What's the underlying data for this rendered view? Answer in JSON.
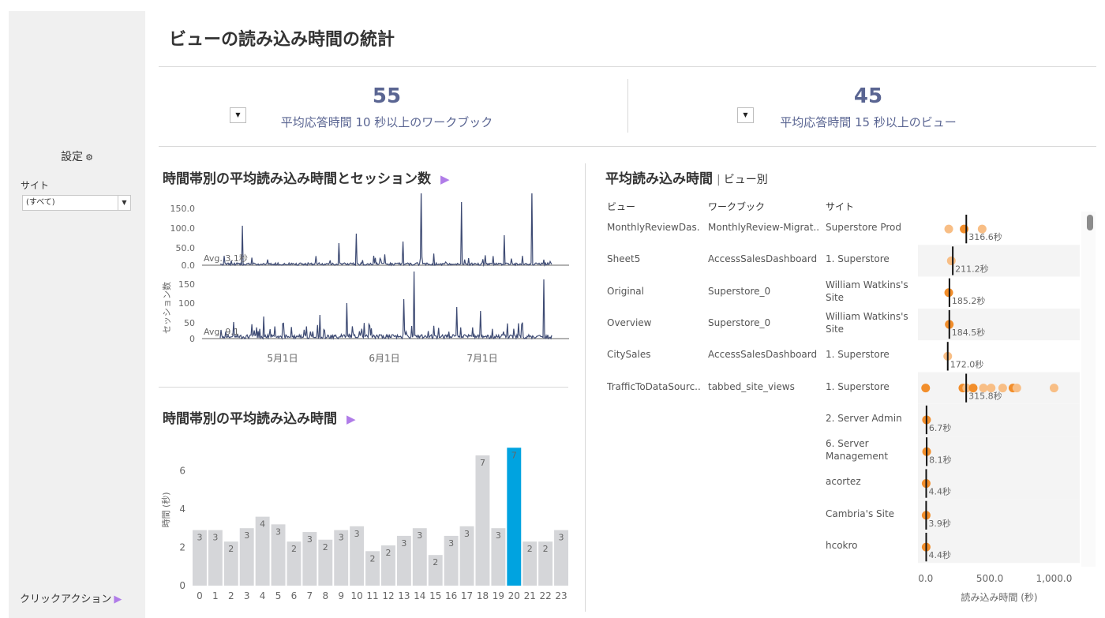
{
  "page": {
    "title": "ビューの読み込み時間の統計"
  },
  "sidebar": {
    "settings_label": "設定",
    "settings_icon": "gear-icon",
    "site_label": "サイト",
    "site_value": "(すべて)",
    "click_action_label": "クリックアクション"
  },
  "kpis": [
    {
      "value": "55",
      "label": "平均応答時間 10 秒以上のワークブック"
    },
    {
      "value": "45",
      "label": "平均応答時間 15 秒以上のビュー"
    }
  ],
  "colors": {
    "line": "#3d4a73",
    "bar": "#d5d6d9",
    "bar_highlight": "#00a3e0",
    "dot_dark": "#f28e2b",
    "dot_light": "#f8be85",
    "accent_tri": "#b07ce8",
    "kpi_text": "#5a6592"
  },
  "line_chart": {
    "title": "時間帯別の平均読み込み時間とセッション数",
    "top_yticks": [
      "150.0",
      "100.0",
      "50.0",
      "0.0"
    ],
    "top_avg_label": "Avg. 3.1秒",
    "bottom_ylabel": "セッション数",
    "bottom_yticks": [
      "150",
      "100",
      "50",
      "0"
    ],
    "bottom_avg_label": "Avg. 9.1",
    "xticks": [
      "5月1日",
      "6月1日",
      "7月1日"
    ]
  },
  "chart_data": [
    {
      "type": "bar",
      "title": "時間帯別の平均読み込み時間",
      "ylabel": "時間 (秒)",
      "categories": [
        "0",
        "1",
        "2",
        "3",
        "4",
        "5",
        "6",
        "7",
        "8",
        "9",
        "10",
        "11",
        "12",
        "13",
        "14",
        "15",
        "16",
        "17",
        "18",
        "19",
        "20",
        "21",
        "22",
        "23"
      ],
      "values": [
        3,
        3,
        2,
        3,
        4,
        3,
        2,
        3,
        2,
        3,
        3,
        2,
        2,
        3,
        3,
        2,
        3,
        3,
        7,
        3,
        7,
        2,
        2,
        3
      ],
      "heights": [
        2.9,
        2.9,
        2.3,
        3.0,
        3.6,
        3.2,
        2.3,
        2.8,
        2.4,
        2.9,
        3.1,
        1.8,
        2.1,
        2.6,
        3.0,
        1.6,
        2.6,
        3.1,
        6.8,
        3.0,
        7.2,
        2.3,
        2.3,
        2.9
      ],
      "highlight_index": 20,
      "yticks": [
        0,
        2,
        4,
        6
      ],
      "ylim": [
        0,
        7.5
      ],
      "grid": false
    },
    {
      "type": "scatter",
      "title": "平均読み込み時間",
      "subtitle": "ビュー別",
      "xlabel": "読み込み時間 (秒)",
      "xticks": [
        "0.0",
        "500.0",
        "1,000.0"
      ],
      "xlim": [
        -60,
        1200
      ],
      "columns": [
        "ビュー",
        "ワークブック",
        "サイト"
      ],
      "rows": [
        {
          "view": "MonthlyReviewDas..",
          "workbook": "MonthlyReview-Migrat..",
          "site": "Superstore Prod",
          "avg": 316.6,
          "avg_label": "316.6秒",
          "points": [
            180,
            300,
            440
          ],
          "dark": [
            300
          ]
        },
        {
          "view": "Sheet5",
          "workbook": "AccessSalesDashboard",
          "site": "1. Superstore",
          "avg": 211.2,
          "avg_label": "211.2秒",
          "points": [
            200
          ],
          "dark": []
        },
        {
          "view": "Original",
          "workbook": "Superstore_0",
          "site": "William Watkins's Site",
          "avg": 185.2,
          "avg_label": "185.2秒",
          "points": [
            180
          ],
          "dark": [
            180
          ]
        },
        {
          "view": "Overview",
          "workbook": "Superstore_0",
          "site": "William Watkins's Site",
          "avg": 184.5,
          "avg_label": "184.5秒",
          "points": [
            184
          ],
          "dark": [
            184
          ]
        },
        {
          "view": "CitySales",
          "workbook": "AccessSalesDashboard",
          "site": "1. Superstore",
          "avg": 172.0,
          "avg_label": "172.0秒",
          "points": [
            172
          ],
          "dark": []
        },
        {
          "view": "TrafficToDataSourc..",
          "workbook": "tabbed_site_views",
          "site": "1. Superstore",
          "avg": 315.8,
          "avg_label": "315.8秒",
          "points": [
            0,
            290,
            320,
            370,
            450,
            510,
            600,
            680,
            710,
            1000
          ],
          "dark": [
            0,
            290,
            370,
            680
          ]
        },
        {
          "view": "",
          "workbook": "",
          "site": "2. Server Admin",
          "avg": 6.7,
          "avg_label": "6.7秒",
          "points": [
            7
          ],
          "dark": [
            7
          ]
        },
        {
          "view": "",
          "workbook": "",
          "site": "6. Server Management",
          "avg": 8.1,
          "avg_label": "8.1秒",
          "points": [
            8
          ],
          "dark": [
            8
          ]
        },
        {
          "view": "",
          "workbook": "",
          "site": "acortez",
          "avg": 4.4,
          "avg_label": "4.4秒",
          "points": [
            4
          ],
          "dark": [
            4
          ]
        },
        {
          "view": "",
          "workbook": "",
          "site": "Cambria's Site",
          "avg": 3.9,
          "avg_label": "3.9秒",
          "points": [
            4
          ],
          "dark": [
            4
          ]
        },
        {
          "view": "",
          "workbook": "",
          "site": "hcokro",
          "avg": 4.4,
          "avg_label": "4.4秒",
          "points": [
            4
          ],
          "dark": [
            4
          ]
        }
      ]
    }
  ]
}
